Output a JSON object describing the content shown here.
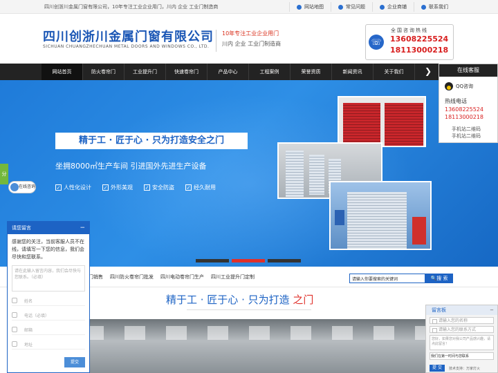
{
  "topbar": {
    "intro": "四川创浙川金属门窗有限公司，10年专注工业企业用门，川内 企业 工业门制造商",
    "links": [
      {
        "label": "网站地图",
        "icon": "location-icon"
      },
      {
        "label": "常见问题",
        "icon": "bulb-icon"
      },
      {
        "label": "企业商铺",
        "icon": "shop-icon"
      },
      {
        "label": "联系我们",
        "icon": "phone-icon"
      }
    ]
  },
  "header": {
    "logo_cn": "四川创浙川金属门窗有限公司",
    "logo_en": "SICHUAN CHUANGZHECHUAN METAL DOORS AND WINDOWS CO., LTD.",
    "slogan_line1": "10年专注工业企业用门",
    "slogan_line2": "川内 企业 工业门制造商",
    "hotline_title": "全国咨询热线",
    "hotline_numbers": [
      "13608225524",
      "18113000218"
    ]
  },
  "nav": {
    "items": [
      "网站首页",
      "防火卷帘门",
      "工业提升门",
      "快速卷帘门",
      "产品中心",
      "工程案例",
      "荣誉资质",
      "新闻资讯",
      "关于我们"
    ],
    "active_index": 0,
    "more_icon": "chevron-right-icon"
  },
  "banner": {
    "title": "精于工 · 匠于心 · 只为打造安全之门",
    "subtitle": "坐拥8000㎡生产车间   引进国外先进生产设备",
    "features": [
      "人性化设计",
      "外形美观",
      "安全防盗",
      "经久耐用"
    ],
    "slide_count": 3,
    "active_slide": 1
  },
  "online_panel": {
    "title": "在线客服",
    "qq_label": "QQ咨询",
    "hotline_label": "热线电话",
    "numbers": [
      "13608225524",
      "18113000218"
    ],
    "qr_labels": [
      "手机站二维码",
      "手机站二维码"
    ]
  },
  "side_tab": {
    "label": "分",
    "chat_label": "在线咨询"
  },
  "search": {
    "hot_links": [
      "门销售",
      "四川防火卷帘门批发",
      "四川电动卷帘门生产",
      "四川工业提升门定制"
    ],
    "placeholder": "请输入你要搜索的关键词",
    "button": "搜 索"
  },
  "mid_slogan": {
    "text": "精于工 · 匠于心 · 只为打造",
    "highlight": "之门"
  },
  "message_popup": {
    "title": "请您留言",
    "intro": "感谢您的关注，当前客服人员不在线，请填写一下您的信息，我们会尽快和您联系。",
    "textarea_placeholder": "请在此输入留言内容，我们会尽快与您联系。（必填）",
    "fields": [
      "姓名",
      "电话（必填）",
      "邮箱",
      "地址"
    ],
    "submit": "提交"
  },
  "message_board": {
    "title": "留言板",
    "name_placeholder": "请输入您的名称",
    "contact_placeholder": "请输入您的联系方式",
    "content_placeholder": "您好，如果您对我公司产品感兴趣，请点此留言！",
    "notice": "我们在第一时间与您联系",
    "submit": "提 交",
    "support": "技术支持：万家灯火"
  }
}
